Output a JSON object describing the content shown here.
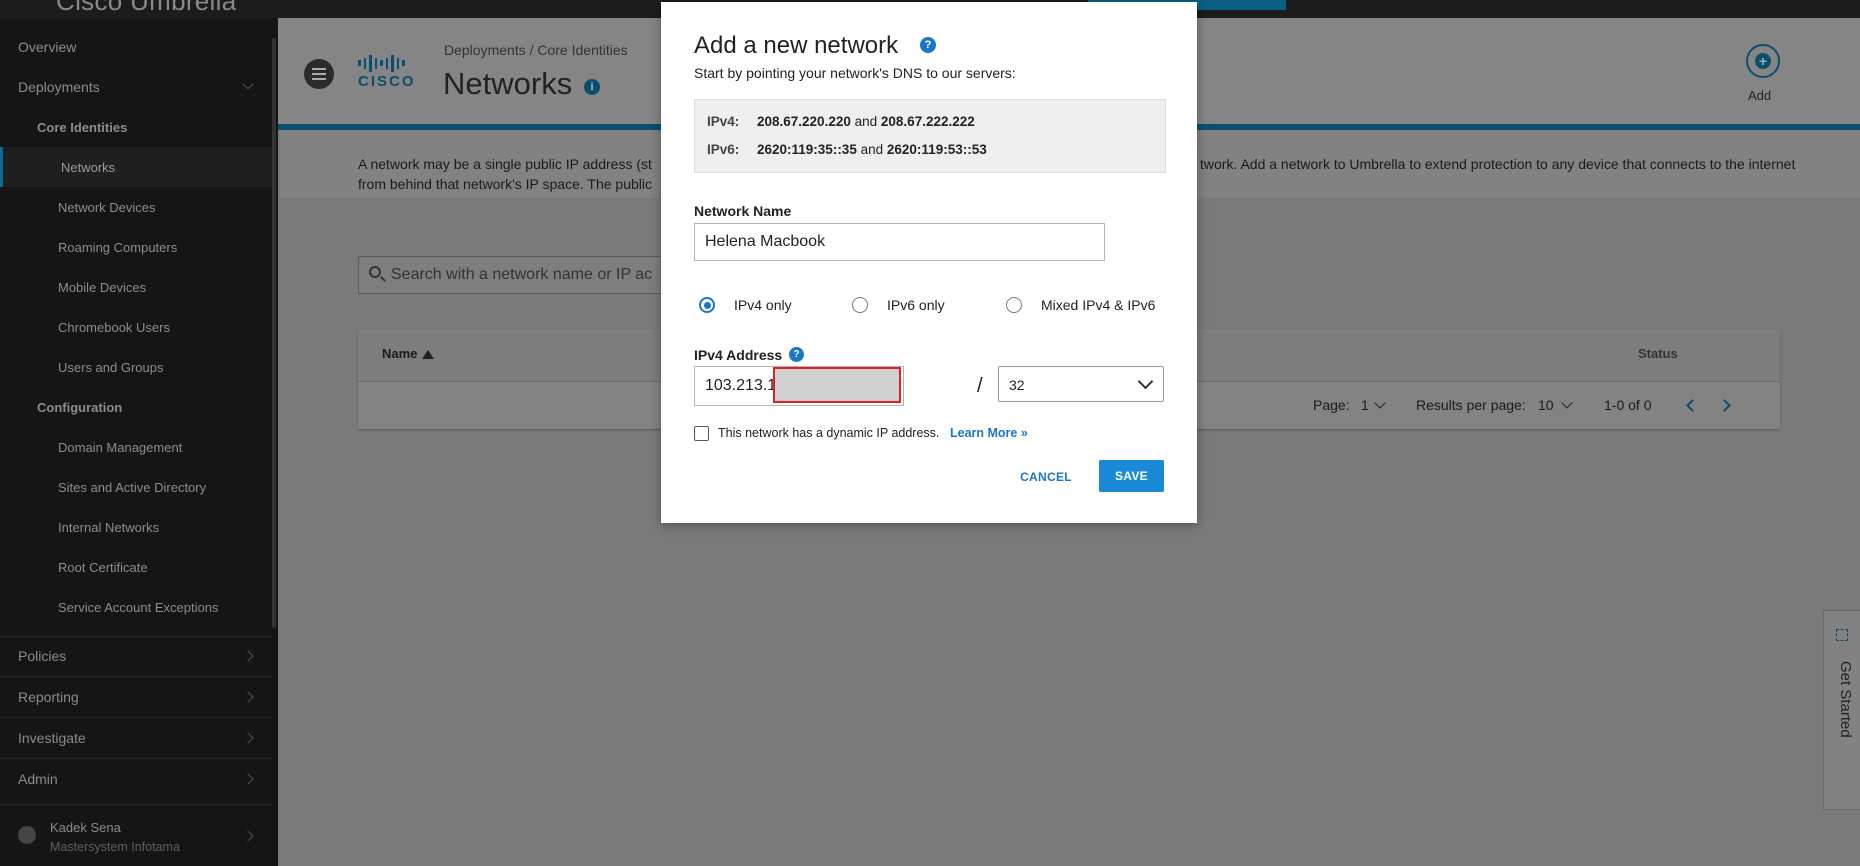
{
  "app": {
    "brand": "Cisco Umbrella"
  },
  "sidebar": {
    "overview": "Overview",
    "deployments": "Deployments",
    "core_identities": "Core Identities",
    "items": [
      "Networks",
      "Network Devices",
      "Roaming Computers",
      "Mobile Devices",
      "Chromebook Users",
      "Users and Groups"
    ],
    "configuration": "Configuration",
    "config_items": [
      "Domain Management",
      "Sites and Active Directory",
      "Internal Networks",
      "Root Certificate",
      "Service Account Exceptions"
    ],
    "policies": "Policies",
    "reporting": "Reporting",
    "investigate": "Investigate",
    "admin": "Admin",
    "user": {
      "name": "Kadek Sena",
      "org": "Mastersystem Infotama"
    }
  },
  "header": {
    "logo_text": "CISCO",
    "breadcrumb": "Deployments / Core Identities",
    "title": "Networks",
    "info_icon": "i",
    "add_label": "Add"
  },
  "main": {
    "description_line1": "A network may be a single public IP address (st",
    "description_line1_end": "twork. Add a network to Umbrella to extend protection to any device that connects to the internet",
    "description_line2": "from behind that network's IP space. The public",
    "search_placeholder": "Search with a network name or IP ac",
    "table": {
      "col_name": "Name",
      "col_status": "Status",
      "page_label": "Page:",
      "page_value": "1",
      "results_label": "Results per page:",
      "results_value": "10",
      "range": "1-0 of 0"
    },
    "get_started": "Get Started"
  },
  "modal": {
    "title": "Add a new network",
    "help": "?",
    "subtitle": "Start by pointing your network's DNS to our servers:",
    "ipv4_key": "IPv4:",
    "ipv4_a": "208.67.220.220",
    "ipv4_b": "208.67.222.222",
    "ipv6_key": "IPv6:",
    "ipv6_a": "2620:119:35::35",
    "ipv6_b": "2620:119:53::53",
    "and": "and",
    "network_name_label": "Network Name",
    "network_name_value": "Helena Macbook",
    "radio_ipv4": "IPv4 only",
    "radio_ipv6": "IPv6 only",
    "radio_mixed": "Mixed IPv4 & IPv6",
    "ipv4_address_label": "IPv4 Address",
    "ipv4_address_value": "103.213.1",
    "slash": "/",
    "cidr_value": "32",
    "dynamic_label": "This network has a dynamic IP address.",
    "learn_more": "Learn More »",
    "cancel": "CANCEL",
    "save": "SAVE"
  },
  "colors": {
    "accent": "#1b76c6",
    "save_button": "#1b8ad6",
    "redaction_border": "#e02020"
  }
}
